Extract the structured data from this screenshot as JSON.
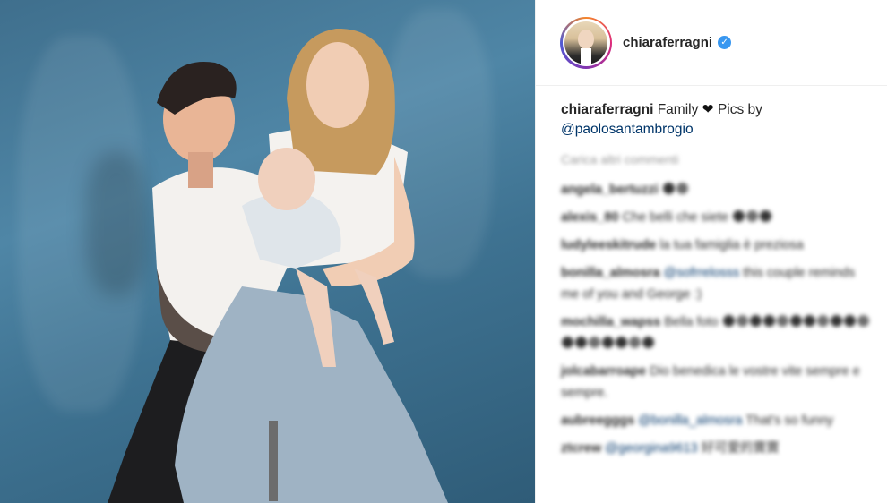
{
  "post": {
    "username": "chiaraferragni",
    "verified_icon": "verified-badge-icon",
    "caption": {
      "username": "chiaraferragni",
      "text": "Family",
      "heart_icon": "❤",
      "text2": "Pics by",
      "mention": "@paolosantambrogio"
    },
    "load_more": "Carica altri commenti",
    "comments": [
      {
        "user": "angela_bertuzzi",
        "text": "",
        "emoji": 2
      },
      {
        "user": "alexis_80",
        "text": "Che belli che siete",
        "emoji": 3
      },
      {
        "user": "ludyleeskitrude",
        "text": "la tua famiglia è preziosa",
        "emoji": 0
      },
      {
        "user": "bonilla_almosra",
        "mention": "@sofrrelosss",
        "text": "this couple reminds me of you and George :)",
        "emoji": 0
      },
      {
        "user": "mochilla_wapss",
        "text": "Bella foto",
        "emoji": 18
      },
      {
        "user": "jolcabarroape",
        "text": "Dio benedica le vostre vite sempre e sempre.",
        "emoji": 0
      },
      {
        "user": "aubreegggs",
        "mention": "@bonilla_almosra",
        "text": "That's so funny",
        "emoji": 0
      },
      {
        "user": "ztcrew",
        "mention": "@georgina9613",
        "text": "好可愛的寶寶",
        "emoji": 0
      }
    ]
  },
  "colors": {
    "backdrop": "#4f86a6",
    "link": "#003569",
    "verified": "#3897f0",
    "border": "#efefef"
  }
}
